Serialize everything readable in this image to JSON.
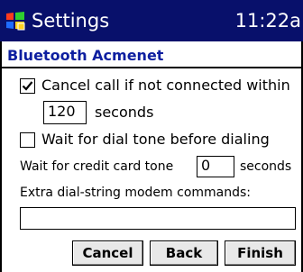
{
  "titlebar": {
    "title": "Settings",
    "clock": "11:22a"
  },
  "header": {
    "title": "Bluetooth Acmenet"
  },
  "options": {
    "cancel_call": {
      "label": "Cancel call if not connected within",
      "checked": true
    },
    "timeout_value": "120",
    "timeout_unit": "seconds",
    "wait_dial_tone": {
      "label": "Wait for dial tone before dialing",
      "checked": false
    },
    "credit_card_label": "Wait for credit card tone",
    "credit_card_value": "0",
    "credit_card_unit": "seconds",
    "extra_commands_label": "Extra dial-string modem commands:",
    "extra_commands_value": ""
  },
  "buttons": {
    "cancel": "Cancel",
    "back": "Back",
    "finish": "Finish"
  },
  "colors": {
    "titlebar_bg": "#08106b",
    "header_text": "#0e1fa0"
  },
  "icons": {
    "logo": "windows-flag-icon",
    "check": "checkmark-icon"
  }
}
